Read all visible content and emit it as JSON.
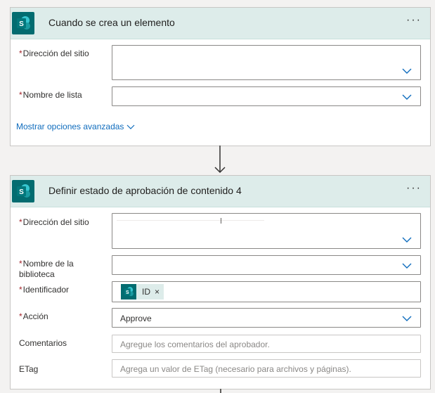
{
  "card1": {
    "title": "Cuando se crea un elemento",
    "more": "···",
    "site_label": "Dirección del sitio",
    "list_label": "Nombre de lista",
    "advanced_label": "Mostrar opciones avanzadas",
    "required_mark": "*"
  },
  "card2": {
    "title": "Definir estado de aprobación de contenido 4",
    "more": "···",
    "site_label": "Dirección del sitio",
    "library_label": "Nombre de la biblioteca",
    "id_label": "Identificador",
    "id_token": "ID",
    "id_token_remove": "×",
    "action_label": "Acción",
    "action_value": "Approve",
    "comments_label": "Comentarios",
    "comments_placeholder": "Agregue los comentarios del aprobador.",
    "etag_label": "ETag",
    "etag_placeholder": "Agrega un valor de ETag (necesario para archivos y páginas).",
    "required_mark": "*"
  },
  "colors": {
    "header_bg": "#ddecea",
    "sharepoint": "#036c70",
    "link": "#0f6cbd",
    "required": "#a4262c",
    "chevron": "#0f6cbd"
  },
  "icons": {
    "app": "sharepoint-icon",
    "dropdown": "chevron-down-icon",
    "connector": "arrow-down-icon"
  }
}
